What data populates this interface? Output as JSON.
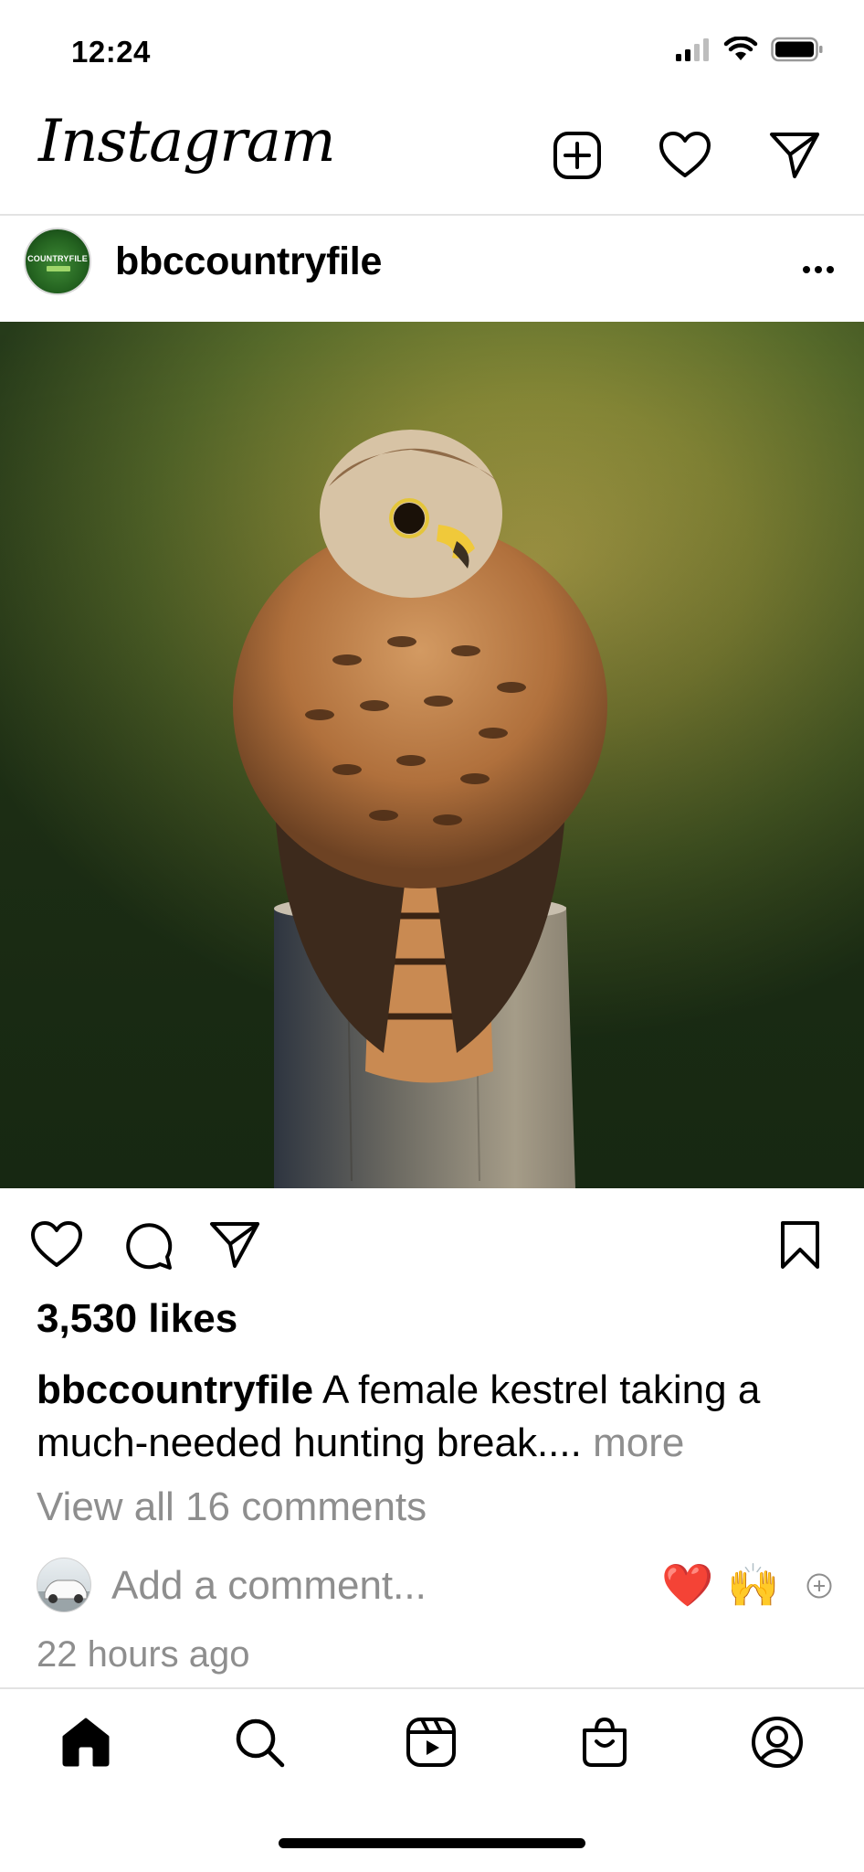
{
  "status_bar": {
    "time": "12:24",
    "icons": [
      "signal-icon",
      "wifi-icon",
      "battery-icon"
    ]
  },
  "header": {
    "logo_text": "Instagram",
    "icons": [
      "new-post-icon",
      "activity-heart-icon",
      "direct-message-icon"
    ]
  },
  "post": {
    "username": "bbccountryfile",
    "avatar_text": "COUNTRYFILE",
    "menu_icon": "more-dots-icon",
    "image_alt": "Female kestrel perched on a wooden post",
    "actions": [
      "like-icon",
      "comment-icon",
      "share-icon",
      "save-icon"
    ],
    "likes": "3,530 likes",
    "caption": {
      "username": "bbccountryfile",
      "text": " A female kestrel taking a much-needed hunting break....",
      "more": " more"
    },
    "view_comments": "View all 16 comments",
    "add_comment_placeholder": "Add a comment...",
    "quick_emojis": [
      "❤️",
      "🙌"
    ],
    "time_ago": "22 hours ago"
  },
  "tab_bar": {
    "items": [
      "home-icon",
      "search-icon",
      "reels-icon",
      "shop-icon",
      "profile-icon"
    ],
    "active": "home-icon"
  },
  "colors": {
    "text": "#000000",
    "secondary_text": "#8e8e8e",
    "divider": "#e3e3e3",
    "heart_red": "#ff3040"
  }
}
